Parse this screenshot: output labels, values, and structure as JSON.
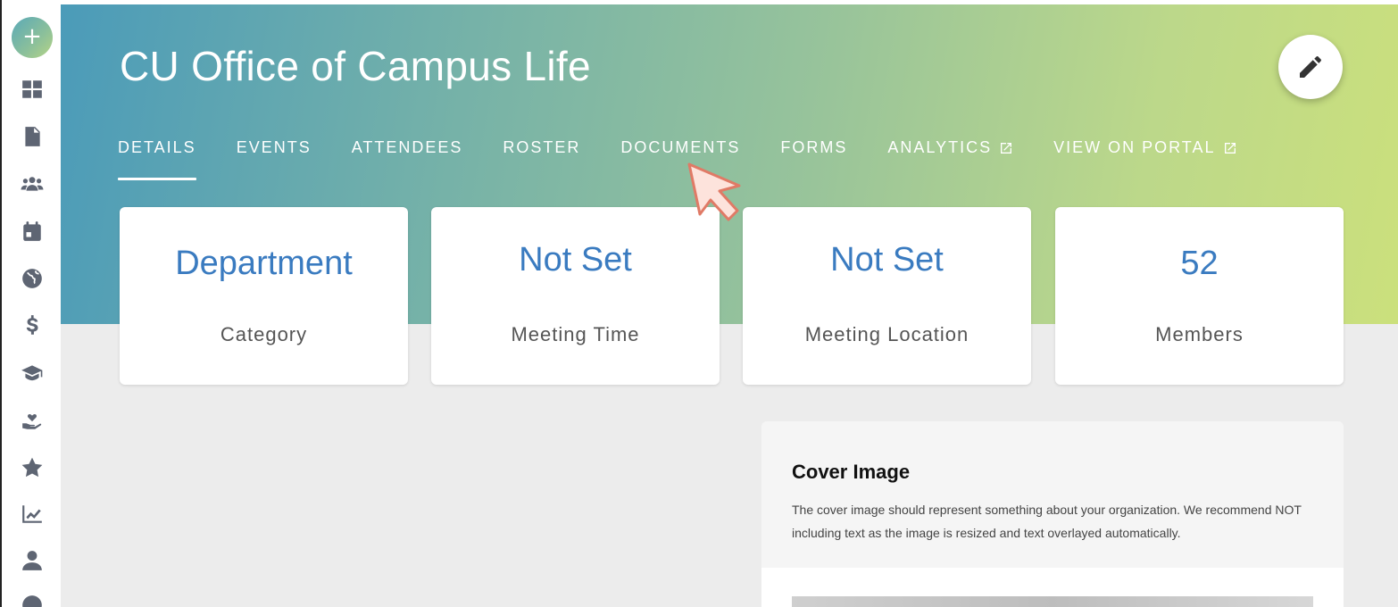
{
  "app": {
    "title": "CU Office of Campus Life"
  },
  "sidebar": {
    "add_label": "+",
    "items": [
      {
        "name": "dashboard-icon"
      },
      {
        "name": "document-icon"
      },
      {
        "name": "users-icon"
      },
      {
        "name": "calendar-icon"
      },
      {
        "name": "globe-icon"
      },
      {
        "name": "dollar-icon"
      },
      {
        "name": "graduation-cap-icon"
      },
      {
        "name": "hand-heart-icon"
      },
      {
        "name": "star-icon"
      },
      {
        "name": "chart-line-icon"
      },
      {
        "name": "user-icon"
      },
      {
        "name": "compass-icon"
      }
    ]
  },
  "tabs": [
    {
      "label": "DETAILS",
      "active": true
    },
    {
      "label": "EVENTS"
    },
    {
      "label": "ATTENDEES"
    },
    {
      "label": "ROSTER"
    },
    {
      "label": "DOCUMENTS"
    },
    {
      "label": "FORMS"
    },
    {
      "label": "ANALYTICS",
      "external": true
    },
    {
      "label": "VIEW ON PORTAL",
      "external": true
    }
  ],
  "cards": [
    {
      "value": "Department",
      "label": "Category"
    },
    {
      "value": "Not Set",
      "label": "Meeting Time"
    },
    {
      "value": "Not Set",
      "label": "Meeting Location"
    },
    {
      "value": "52",
      "label": "Members"
    }
  ],
  "cover": {
    "title": "Cover Image",
    "description": "The cover image should represent something about your organization. We recommend NOT including text as the image is resized and text overlayed automatically."
  },
  "colors": {
    "accent": "#3a7bc0",
    "gradient_start": "#4b9bb9",
    "gradient_end": "#cbe07c",
    "sidebar_icon": "#5e6573"
  }
}
